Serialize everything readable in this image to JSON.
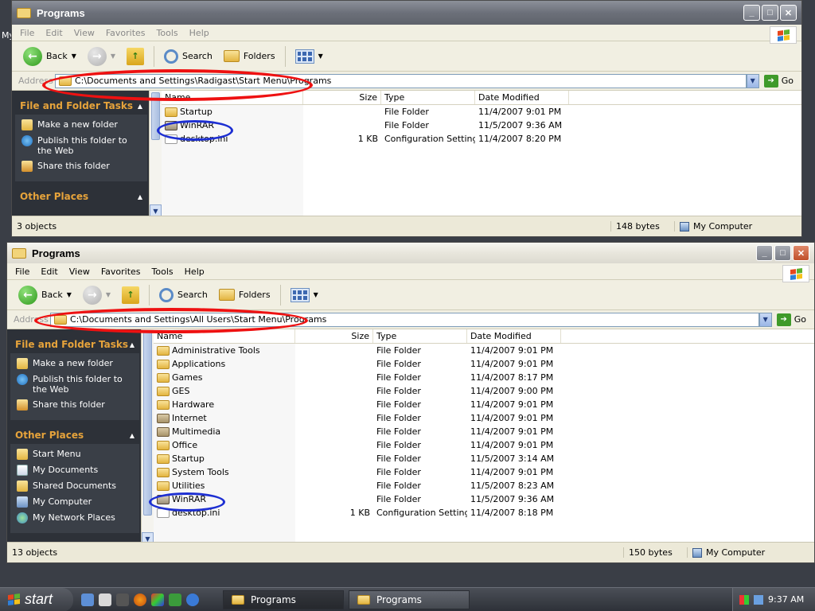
{
  "desktop": {
    "partial_label": "My"
  },
  "window1": {
    "title": "Programs",
    "menu": [
      "File",
      "Edit",
      "View",
      "Favorites",
      "Tools",
      "Help"
    ],
    "toolbar": {
      "back": "Back",
      "search": "Search",
      "folders": "Folders"
    },
    "address": {
      "label": "Address",
      "value": "C:\\Documents and Settings\\Radigast\\Start Menu\\Programs",
      "go": "Go"
    },
    "tasks": {
      "file_folder_title": "File and Folder Tasks",
      "items": [
        "Make a new folder",
        "Publish this folder to the Web",
        "Share this folder"
      ],
      "other_places_title": "Other Places"
    },
    "columns": {
      "name": "Name",
      "size": "Size",
      "type": "Type",
      "date": "Date Modified"
    },
    "rows": [
      {
        "name": "Startup",
        "size": "",
        "type": "File Folder",
        "date": "11/4/2007 9:01 PM",
        "icon": "folder-icon"
      },
      {
        "name": "WinRAR",
        "size": "",
        "type": "File Folder",
        "date": "11/5/2007 9:36 AM",
        "icon": "program-folder-icon"
      },
      {
        "name": "desktop.ini",
        "size": "1 KB",
        "type": "Configuration Settings",
        "date": "11/4/2007 8:20 PM",
        "icon": "ini-file-icon"
      }
    ],
    "status": {
      "objects": "3 objects",
      "bytes": "148 bytes",
      "location": "My Computer"
    }
  },
  "window2": {
    "title": "Programs",
    "menu": [
      "File",
      "Edit",
      "View",
      "Favorites",
      "Tools",
      "Help"
    ],
    "toolbar": {
      "back": "Back",
      "search": "Search",
      "folders": "Folders"
    },
    "address": {
      "label": "Address",
      "value": "C:\\Documents and Settings\\All Users\\Start Menu\\Programs",
      "go": "Go"
    },
    "tasks": {
      "file_folder_title": "File and Folder Tasks",
      "items": [
        "Make a new folder",
        "Publish this folder to the Web",
        "Share this folder"
      ],
      "other_places_title": "Other Places",
      "places": [
        "Start Menu",
        "My Documents",
        "Shared Documents",
        "My Computer",
        "My Network Places"
      ]
    },
    "columns": {
      "name": "Name",
      "size": "Size",
      "type": "Type",
      "date": "Date Modified"
    },
    "rows": [
      {
        "name": "Administrative Tools",
        "size": "",
        "type": "File Folder",
        "date": "11/4/2007 9:01 PM"
      },
      {
        "name": "Applications",
        "size": "",
        "type": "File Folder",
        "date": "11/4/2007 9:01 PM"
      },
      {
        "name": "Games",
        "size": "",
        "type": "File Folder",
        "date": "11/4/2007 8:17 PM"
      },
      {
        "name": "GES",
        "size": "",
        "type": "File Folder",
        "date": "11/4/2007 9:00 PM"
      },
      {
        "name": "Hardware",
        "size": "",
        "type": "File Folder",
        "date": "11/4/2007 9:01 PM"
      },
      {
        "name": "Internet",
        "size": "",
        "type": "File Folder",
        "date": "11/4/2007 9:01 PM"
      },
      {
        "name": "Multimedia",
        "size": "",
        "type": "File Folder",
        "date": "11/4/2007 9:01 PM"
      },
      {
        "name": "Office",
        "size": "",
        "type": "File Folder",
        "date": "11/4/2007 9:01 PM"
      },
      {
        "name": "Startup",
        "size": "",
        "type": "File Folder",
        "date": "11/5/2007 3:14 AM"
      },
      {
        "name": "System Tools",
        "size": "",
        "type": "File Folder",
        "date": "11/4/2007 9:01 PM"
      },
      {
        "name": "Utilities",
        "size": "",
        "type": "File Folder",
        "date": "11/5/2007 8:23 AM"
      },
      {
        "name": "WinRAR",
        "size": "",
        "type": "File Folder",
        "date": "11/5/2007 9:36 AM"
      },
      {
        "name": "desktop.ini",
        "size": "1 KB",
        "type": "Configuration Settings",
        "date": "11/4/2007 8:18 PM"
      }
    ],
    "status": {
      "objects": "13 objects",
      "bytes": "150 bytes",
      "location": "My Computer"
    }
  },
  "taskbar": {
    "start": "start",
    "tasks": [
      "Programs",
      "Programs"
    ],
    "clock": "9:37 AM"
  },
  "colors": {
    "annotation_red": "#e11111",
    "annotation_blue": "#1d2fd2",
    "panel_header": "#e6a33b"
  }
}
